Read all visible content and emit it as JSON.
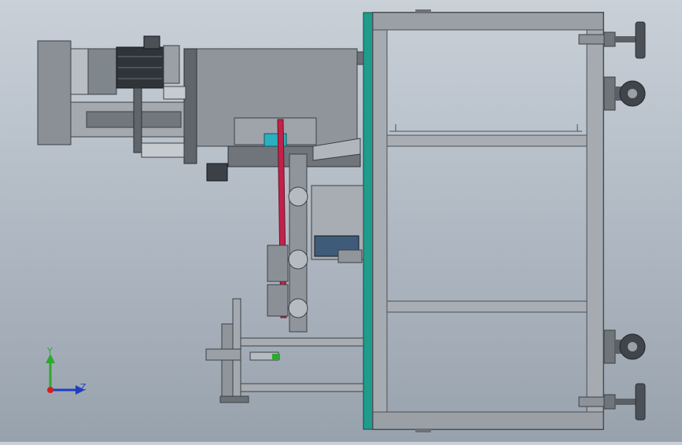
{
  "viewport": {
    "background_top": "#c9d0d8",
    "background_bottom": "#98a2ad"
  },
  "triad": {
    "y_label": "Y",
    "z_label": "Z",
    "y_color": "#2ea82e",
    "z_color": "#1f3fbf",
    "x_color": "#d21f1f"
  },
  "colors": {
    "frame_teal": "#1f9c8c",
    "frame_steel": "#8a9097",
    "belt_red": "#c0234a"
  }
}
